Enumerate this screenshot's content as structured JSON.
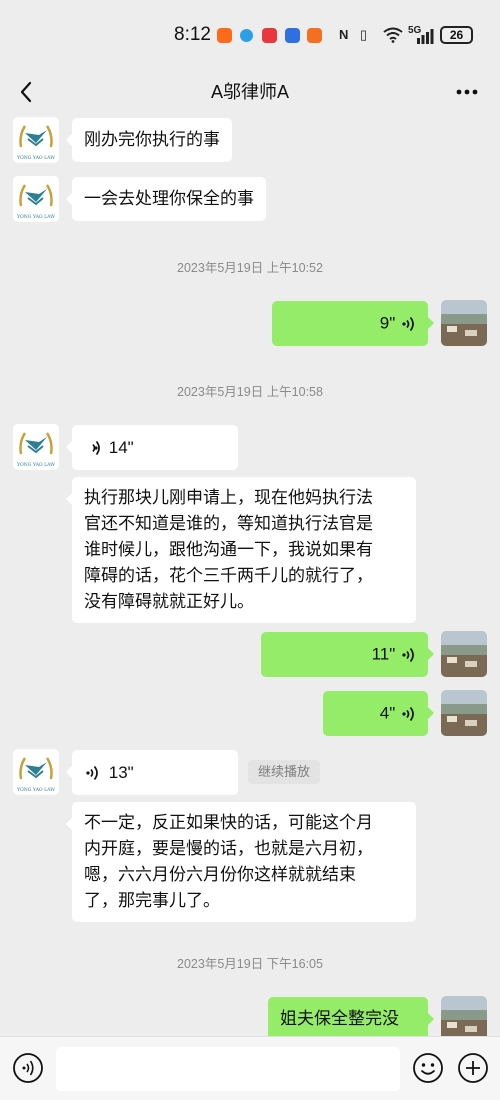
{
  "status_bar": {
    "time": "8:12",
    "network": "5G",
    "battery": "26"
  },
  "header": {
    "title": "A邬律师A"
  },
  "contact": {
    "avatar_caption": "YONG YAO LAW"
  },
  "messages": [
    {
      "type": "text",
      "side": "in",
      "text": "刚办完你执行的事"
    },
    {
      "type": "text",
      "side": "in",
      "text": "一会去处理你保全的事"
    },
    {
      "type": "timestamp",
      "text": "2023年5月19日 上午10:52"
    },
    {
      "type": "voice",
      "side": "out",
      "duration": "9\""
    },
    {
      "type": "timestamp",
      "text": "2023年5月19日 上午10:58"
    },
    {
      "type": "voice",
      "side": "in",
      "duration": "14\""
    },
    {
      "type": "text",
      "side": "in",
      "lines": [
        "执行那块儿刚申请上，现在他妈执行法",
        "官还不知道是谁的，等知道执行法官是",
        "谁时候儿，跟他沟通一下，我说如果有",
        "障碍的话，花个三千两千儿的就行了，",
        "没有障碍就就正好儿。"
      ]
    },
    {
      "type": "voice",
      "side": "out",
      "duration": "11\""
    },
    {
      "type": "voice",
      "side": "out",
      "duration": "4\""
    },
    {
      "type": "voice",
      "side": "in",
      "duration": "13\"",
      "continue_label": "继续播放"
    },
    {
      "type": "text",
      "side": "in",
      "lines": [
        "不一定，反正如果快的话，可能这个月",
        "内开庭，要是慢的话，也就是六月初，",
        "嗯，六六月份六月份你这样就就结束",
        "了，那完事儿了。"
      ]
    },
    {
      "type": "timestamp",
      "text": "2023年5月19日 下午16:05"
    },
    {
      "type": "text",
      "side": "out",
      "text": "姐夫保全整完没"
    }
  ],
  "colors": {
    "background": "#ededed",
    "out_bubble": "#95ec69",
    "in_bubble": "#ffffff",
    "timestamp": "#8a8a8a"
  },
  "icons": {
    "back": "chevron-left-icon",
    "more": "more-dots-icon",
    "voice": "voice-wave-icon",
    "voice_input": "voice-input-icon",
    "emoji": "emoji-icon",
    "add": "plus-icon"
  }
}
